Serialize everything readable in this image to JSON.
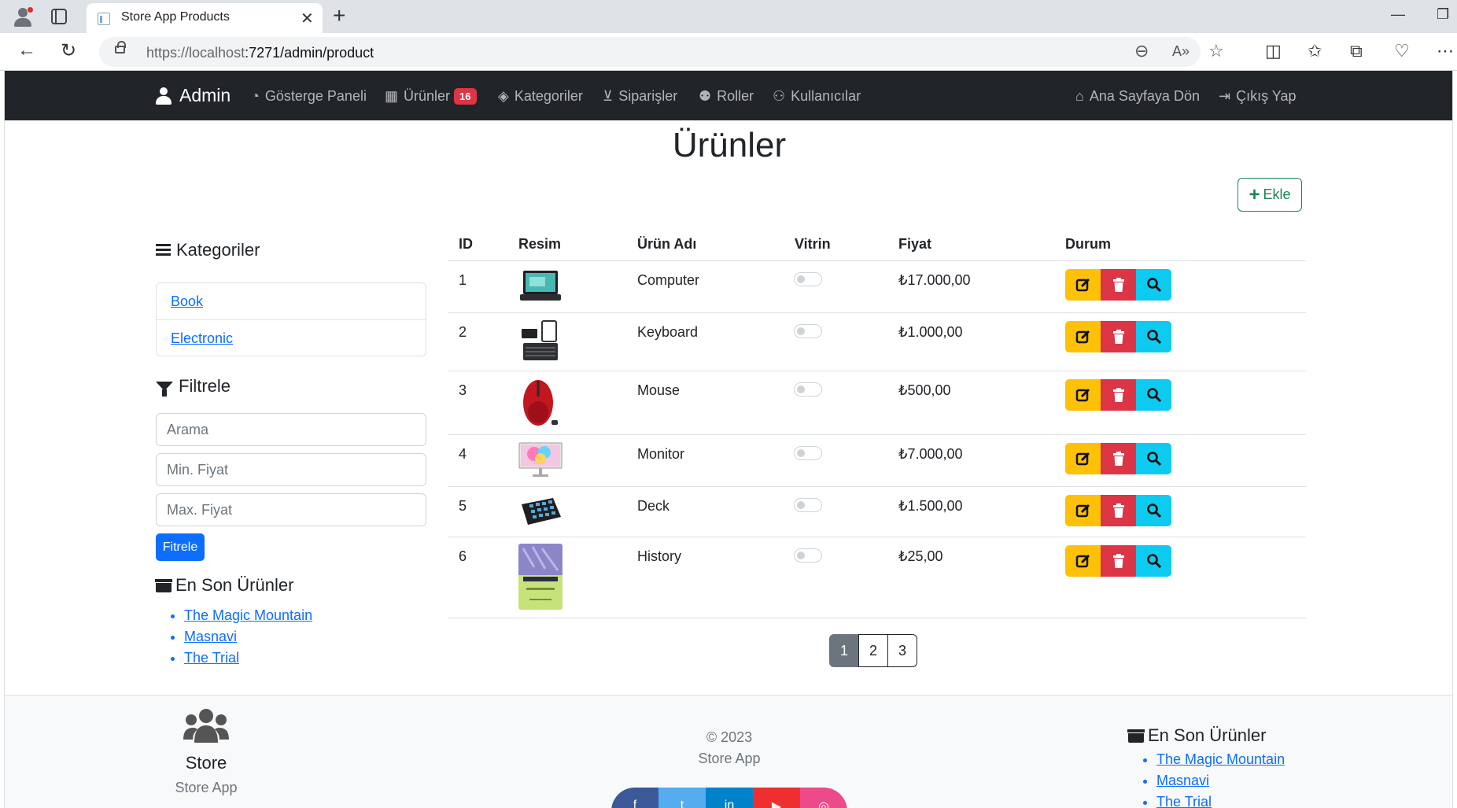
{
  "browser": {
    "tab_title": "Store App Products",
    "url_host": "https://localhost",
    "url_rest": ":7271/admin/product"
  },
  "navbar": {
    "brand": "Admin",
    "items": [
      {
        "label": "Gösterge Paneli",
        "icon": "dashboard-icon"
      },
      {
        "label": "Ürünler",
        "icon": "boxes-icon",
        "badge": "16"
      },
      {
        "label": "Kategoriler",
        "icon": "tags-icon"
      },
      {
        "label": "Siparişler",
        "icon": "basket-icon"
      },
      {
        "label": "Roller",
        "icon": "users-gear-icon"
      },
      {
        "label": "Kullanıcılar",
        "icon": "users-icon"
      }
    ],
    "right": [
      {
        "label": "Ana Sayfaya Dön",
        "icon": "home-icon"
      },
      {
        "label": "Çıkış Yap",
        "icon": "logout-icon"
      }
    ]
  },
  "page": {
    "title": "Ürünler",
    "add_label": "Ekle"
  },
  "sidebar": {
    "categories_title": "Kategoriler",
    "categories": [
      "Book",
      "Electronic"
    ],
    "filter_title": "Filtrele",
    "search_placeholder": "Arama",
    "min_price_placeholder": "Min. Fiyat",
    "max_price_placeholder": "Max. Fiyat",
    "filter_button": "Fitrele",
    "recent_title": "En Son Ürünler",
    "recent": [
      "The Magic Mountain",
      "Masnavi",
      "The Trial"
    ]
  },
  "table": {
    "headers": [
      "ID",
      "Resim",
      "Ürün Adı",
      "Vitrin",
      "Fiyat",
      "Durum"
    ],
    "rows": [
      {
        "id": "1",
        "name": "Computer",
        "price": "₺17.000,00",
        "showcase": false
      },
      {
        "id": "2",
        "name": "Keyboard",
        "price": "₺1.000,00",
        "showcase": false
      },
      {
        "id": "3",
        "name": "Mouse",
        "price": "₺500,00",
        "showcase": false
      },
      {
        "id": "4",
        "name": "Monitor",
        "price": "₺7.000,00",
        "showcase": false
      },
      {
        "id": "5",
        "name": "Deck",
        "price": "₺1.500,00",
        "showcase": false
      },
      {
        "id": "6",
        "name": "History",
        "price": "₺25,00",
        "showcase": false
      }
    ]
  },
  "pagination": {
    "pages": [
      "1",
      "2",
      "3"
    ],
    "current": "1"
  },
  "footer": {
    "store_title": "Store",
    "store_sub": "Store App",
    "copyright": "© 2023",
    "app_name": "Store App",
    "recent_title": "En Son Ürünler",
    "recent": [
      "The Magic Mountain",
      "Masnavi",
      "The Trial"
    ],
    "social_colors": [
      "#3b5998",
      "#55acee",
      "#0082ca",
      "#ed302f",
      "#ec4a89"
    ]
  },
  "colors": {
    "navbar": "#212529",
    "primary": "#0d6efd",
    "success": "#198754",
    "warning": "#ffc107",
    "danger": "#dc3545",
    "info": "#0dcaf0"
  }
}
